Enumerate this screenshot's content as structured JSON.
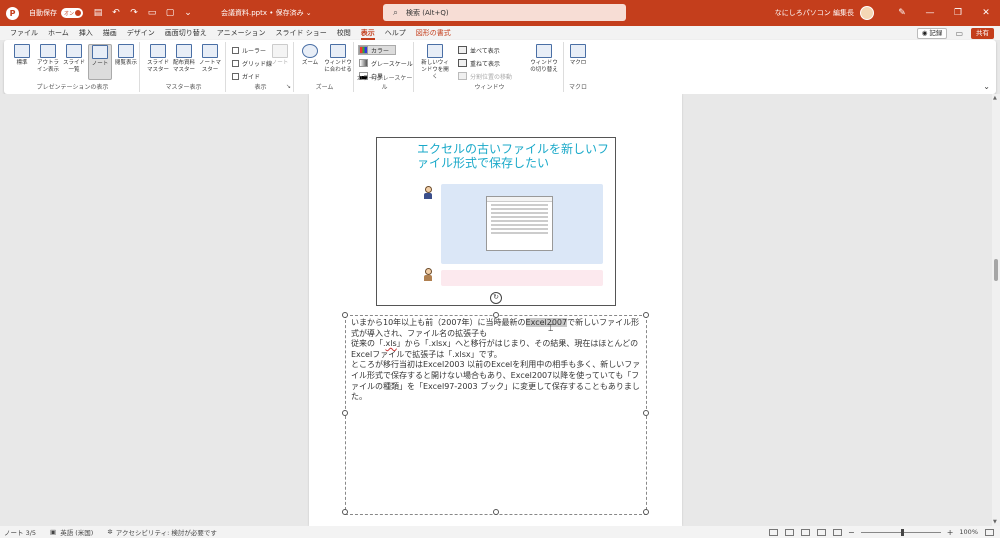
{
  "titlebar": {
    "autosave_label": "自動保存",
    "autosave_state": "オン",
    "doc_title": "会議資料.pptx • 保存済み ⌄",
    "search_placeholder": "検索 (Alt+Q)",
    "user_name": "なにしろパソコン 編集長",
    "qa_icons": [
      "save-icon",
      "undo-icon",
      "redo-icon",
      "present-icon",
      "open-icon",
      "more-icon"
    ]
  },
  "tabs": [
    "ファイル",
    "ホーム",
    "挿入",
    "描画",
    "デザイン",
    "画面切り替え",
    "アニメーション",
    "スライド ショー",
    "校閲",
    "表示",
    "ヘルプ",
    "図形の書式"
  ],
  "active_tab": "表示",
  "tabs_right": {
    "record": "◉ 記録",
    "share": "共有"
  },
  "ribbon": {
    "groups": {
      "presentation_views": {
        "label": "プレゼンテーションの表示",
        "buttons": [
          "標準",
          "アウトライン表示",
          "スライド一覧",
          "ノート",
          "閲覧表示"
        ]
      },
      "master_views": {
        "label": "マスター表示",
        "buttons": [
          "スライドマスター",
          "配布資料マスター",
          "ノートマスター"
        ]
      },
      "show": {
        "label": "表示",
        "checks": [
          "ルーラー",
          "グリッド線",
          "ガイド"
        ],
        "notes_btn": "ノート"
      },
      "zoom": {
        "label": "ズーム",
        "buttons": [
          "ズーム",
          "ウィンドウに合わせる"
        ]
      },
      "color": {
        "label": "カラー/グレースケール",
        "options": [
          "カラー",
          "グレースケール",
          "白黒"
        ]
      },
      "window": {
        "label": "ウィンドウ",
        "new_window": "新しいウィンドウを開く",
        "options": [
          "並べて表示",
          "重ねて表示",
          "分割位置の移動"
        ],
        "switch": "ウィンドウの切り替え"
      },
      "macro": {
        "label": "マクロ",
        "button": "マクロ"
      }
    }
  },
  "slide": {
    "title": "エクセルの古いファイルを新しいファイル形式で保存したい"
  },
  "notes": {
    "before": "いまから10年以上も前（2007年）に当時最新の",
    "highlight": "Excel2007",
    "after": "で新しいファイル形式が導入され、ファイル名の拡張子も",
    "line2a": "従来の「.",
    "line2_squiggle": "xls",
    "line2b": "」から「.xlsx」へと移行がはじまり、その結果、現在はほとんどのExcelファイルで拡張子は「.xlsx」です。",
    "para2": "ところが移行当初はExcel2003 以前のExcelを利用中の相手も多く、新しいファイル形式で保存すると開けない場合もあり、Excel2007以降を使っていても「ファイルの種類」を「Excel97-2003 ブック」に変更して保存することもありました。"
  },
  "statusbar": {
    "page": "ノート 3/5",
    "language": "英語 (米国)",
    "accessibility": "アクセシビリティ: 検討が必要です",
    "zoom": "100%"
  }
}
